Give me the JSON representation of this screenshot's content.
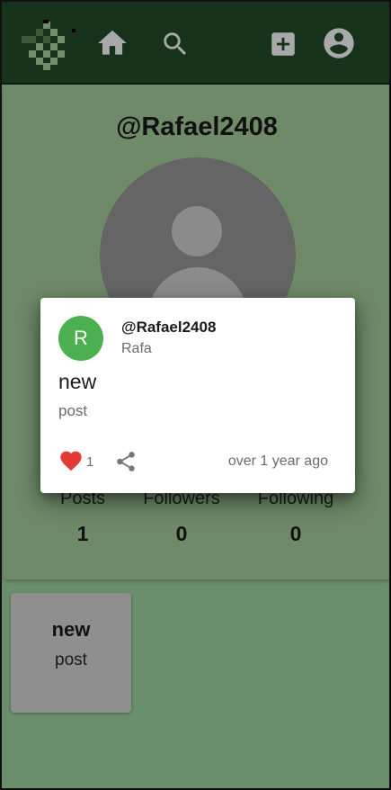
{
  "nav": {
    "logo_icon": "pixel-logo-icon",
    "home_icon": "home-icon",
    "search_icon": "search-icon",
    "add_icon": "add-box-icon",
    "account_icon": "account-circle-icon",
    "bar_color": "#16321a"
  },
  "profile": {
    "username": "@Rafael2408",
    "avatar_icon": "default-avatar-icon",
    "stats": [
      {
        "label": "Posts",
        "value": "1"
      },
      {
        "label": "Followers",
        "value": "0"
      },
      {
        "label": "Following",
        "value": "0"
      }
    ]
  },
  "grid": {
    "posts": [
      {
        "title": "new",
        "body": "post"
      }
    ]
  },
  "modal": {
    "avatar_letter": "R",
    "avatar_color": "#4caf50",
    "handle": "@Rafael2408",
    "name": "Rafa",
    "title": "new",
    "body": "post",
    "likes": "1",
    "like_icon": "heart-icon",
    "like_color": "#e53935",
    "share_icon": "share-icon",
    "time": "over 1 year ago"
  }
}
